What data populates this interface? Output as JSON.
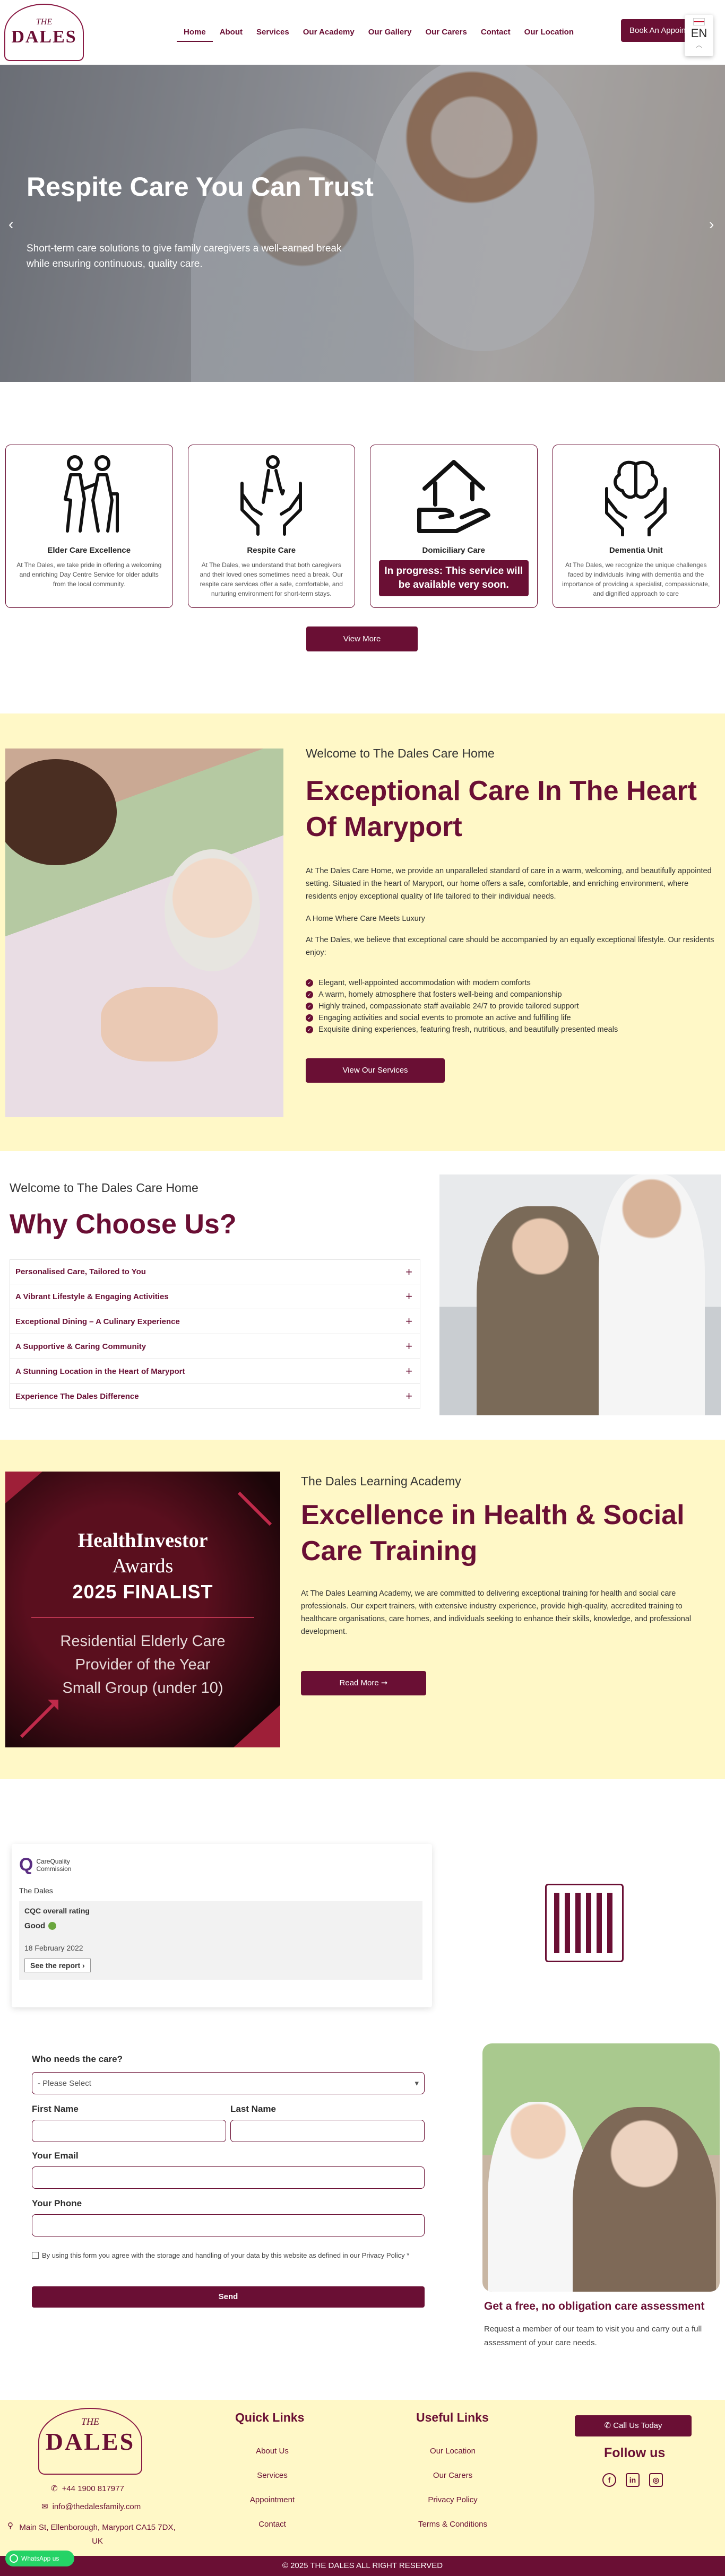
{
  "header": {
    "logo": {
      "the": "THE",
      "name": "DALES"
    },
    "nav": [
      "Home",
      "About",
      "Services",
      "Our Academy",
      "Our Gallery",
      "Our Carers",
      "Contact",
      "Our Location"
    ],
    "book_label": "Book An Appointment",
    "lang": "EN"
  },
  "hero": {
    "title": "Respite Care You Can Trust",
    "subtitle": "Short-term care solutions to give family caregivers a well-earned break while ensuring continuous, quality care.",
    "prev": "‹",
    "next": "›"
  },
  "services": {
    "cards": [
      {
        "title": "Elder Care Excellence",
        "text": "At The Dales, we take pride in offering a welcoming and enriching Day Centre Service for older adults from the local community."
      },
      {
        "title": "Respite Care",
        "text": "At The Dales, we understand that both caregivers and their loved ones sometimes need a break. Our respite care services offer a safe, comfortable, and nurturing environment for short-term stays."
      },
      {
        "title": "Domiciliary Care",
        "progress": "In progress: This service will be available very soon."
      },
      {
        "title": "Dementia Unit",
        "text": "At The Dales, we recognize the unique challenges faced by individuals living with dementia and the importance of providing a specialist, compassionate, and dignified approach to care"
      }
    ],
    "view_more": "View More"
  },
  "welcome": {
    "eyebrow": "Welcome to The Dales Care Home",
    "title": "Exceptional Care In The Heart Of Maryport",
    "p1": "At The Dales Care Home, we provide an unparalleled standard of care in a warm, welcoming, and beautifully appointed setting. Situated in the heart of Maryport, our home offers a safe, comfortable, and enriching environment, where residents enjoy exceptional quality of life tailored to their individual needs.",
    "p2": "A Home Where Care Meets Luxury",
    "p3": "At The Dales, we believe that exceptional care should be accompanied by an equally exceptional lifestyle. Our residents enjoy:",
    "features": [
      "Elegant, well-appointed accommodation with modern comforts",
      "A warm, homely atmosphere that fosters well-being and companionship",
      "Highly trained, compassionate staff available 24/7 to provide tailored support",
      "Engaging activities and social events to promote an active and fulfilling life",
      "Exquisite dining experiences, featuring fresh, nutritious, and beautifully presented meals"
    ],
    "button": "View Our Services"
  },
  "why": {
    "eyebrow": "Welcome to The Dales Care Home",
    "title": "Why Choose Us?",
    "items": [
      "Personalised Care, Tailored to You",
      "A Vibrant Lifestyle & Engaging Activities",
      "Exceptional Dining – A Culinary Experience",
      "A Supportive & Caring Community",
      "A Stunning Location in the Heart of Maryport",
      "Experience The Dales Difference"
    ]
  },
  "academy": {
    "award": {
      "l1": "HealthInvestor",
      "l2": "Awards",
      "l3": "2025 FINALIST",
      "l4": "Residential Elderly Care",
      "l5": "Provider of the Year",
      "l6": "Small Group (under 10)"
    },
    "eyebrow": "The Dales Learning Academy",
    "title": "Excellence in Health & Social Care Training",
    "text": "At The Dales Learning Academy, we are committed to delivering exceptional training for health and social care professionals. Our expert trainers, with extensive industry experience, provide high-quality, accredited training to healthcare organisations, care homes, and individuals seeking to enhance their skills, knowledge, and professional development.",
    "button": "Read More ➞"
  },
  "cqc": {
    "brand_q": "Q",
    "brand_1": "CareQuality",
    "brand_2": "Commission",
    "location": "The Dales",
    "rating_label": "CQC overall rating",
    "rating": "Good",
    "date": "18 February 2022",
    "report": "See the report ›"
  },
  "form": {
    "who_label": "Who needs the care?",
    "who_value": "- Please Select",
    "first_label": "First Name",
    "last_label": "Last Name",
    "email_label": "Your Email",
    "phone_label": "Your Phone",
    "consent": "By using this form you agree with the storage and handling of your data by this website as defined in our Privacy Policy *",
    "send": "Send"
  },
  "assessment": {
    "title": "Get a free, no obligation care assessment",
    "text": "Request a member of our team to visit you and carry out a full assessment of your care needs."
  },
  "footer": {
    "logo": {
      "the": "THE",
      "name": "DALES"
    },
    "phone": "+44 1900 817977",
    "email": "info@thedalesfamily.com",
    "address": "Main St, Ellenborough, Maryport CA15 7DX, UK",
    "quick_title": "Quick Links",
    "quick": [
      "About Us",
      "Services",
      "Appointment",
      "Contact"
    ],
    "useful_title": "Useful Links",
    "useful": [
      "Our Location",
      "Our Carers",
      "Privacy Policy",
      "Terms & Conditions"
    ],
    "call": "Call Us Today",
    "follow": "Follow us",
    "copyright": "© 2025 THE DALES ALL RIGHT RESERVED",
    "whatsapp": "WhatsApp us"
  }
}
